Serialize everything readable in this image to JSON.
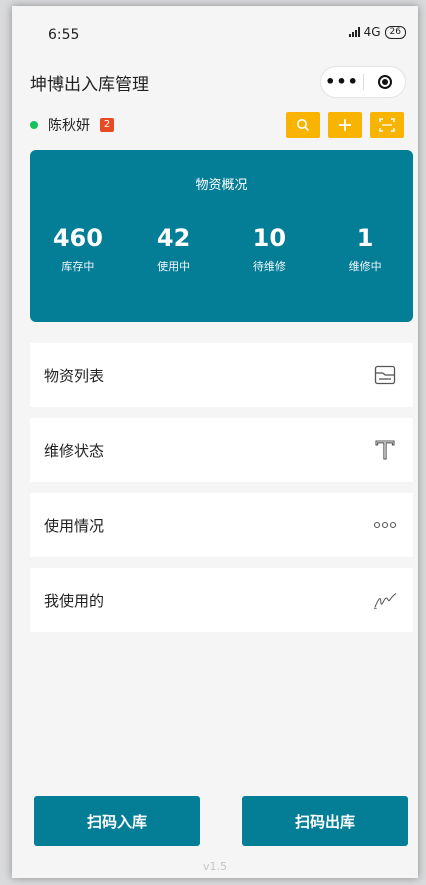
{
  "status_bar": {
    "time": "6:55",
    "network": "4G",
    "battery": "26"
  },
  "nav": {
    "title": "坤博出入库管理"
  },
  "user": {
    "name": "陈秋妍",
    "badge": "2"
  },
  "toolbar": {
    "buttons": [
      "search-icon",
      "plus-icon",
      "scan-icon"
    ],
    "color": "#f8b400"
  },
  "overview": {
    "title": "物资概况",
    "stats": [
      {
        "value": "460",
        "label": "库存中"
      },
      {
        "value": "42",
        "label": "使用中"
      },
      {
        "value": "10",
        "label": "待维修"
      },
      {
        "value": "1",
        "label": "维修中"
      }
    ]
  },
  "menu": [
    {
      "label": "物资列表",
      "icon": "list-card-icon"
    },
    {
      "label": "维修状态",
      "icon": "text-t-icon"
    },
    {
      "label": "使用情况",
      "icon": "more-dots-icon"
    },
    {
      "label": "我使用的",
      "icon": "signature-icon"
    }
  ],
  "actions": {
    "scan_in": "扫码入库",
    "scan_out": "扫码出库"
  },
  "version": "v1.5",
  "colors": {
    "primary": "#047d97",
    "accent": "#f8b400",
    "online": "#19c15c",
    "badge": "#e64b24"
  }
}
